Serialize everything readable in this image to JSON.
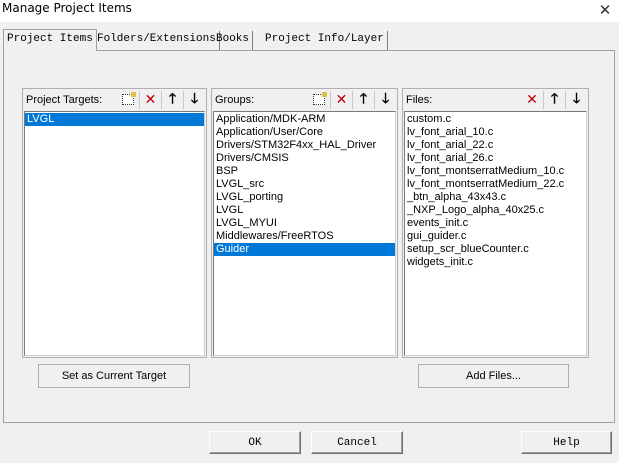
{
  "window": {
    "title": "Manage Project Items",
    "close_glyph": "✕"
  },
  "tabs": [
    {
      "label": "Project Items",
      "active": true
    },
    {
      "label": "Folders/Extensions",
      "active": false
    },
    {
      "label": "Books",
      "active": false
    },
    {
      "label": "Project Info/Layer",
      "active": false
    }
  ],
  "targets": {
    "label": "Project Targets:",
    "items": [
      "LVGL"
    ],
    "selected_index": 0
  },
  "groups": {
    "label": "Groups:",
    "items": [
      "Application/MDK-ARM",
      "Application/User/Core",
      "Drivers/STM32F4xx_HAL_Driver",
      "Drivers/CMSIS",
      "BSP",
      "LVGL_src",
      "LVGL_porting",
      "LVGL",
      "LVGL_MYUI",
      "Middlewares/FreeRTOS",
      "Guider"
    ],
    "selected_index": 10
  },
  "files": {
    "label": "Files:",
    "items": [
      "custom.c",
      "lv_font_arial_10.c",
      "lv_font_arial_22.c",
      "lv_font_arial_26.c",
      "lv_font_montserratMedium_10.c",
      "lv_font_montserratMedium_22.c",
      "_btn_alpha_43x43.c",
      "_NXP_Logo_alpha_40x25.c",
      "events_init.c",
      "gui_guider.c",
      "setup_scr_blueCounter.c",
      "widgets_init.c"
    ]
  },
  "buttons": {
    "set_current_target": "Set as Current Target",
    "add_files": "Add Files...",
    "ok": "OK",
    "cancel": "Cancel",
    "help": "Help"
  },
  "icons": {
    "new": "new-item-icon",
    "delete": "delete-icon",
    "move_up": "arrow-up-icon",
    "move_down": "arrow-down-icon",
    "delete_color": "#c00000",
    "selection_color": "#0078d7"
  },
  "glyphs": {
    "delete": "✕",
    "up": "🡑",
    "down": "🡓"
  }
}
